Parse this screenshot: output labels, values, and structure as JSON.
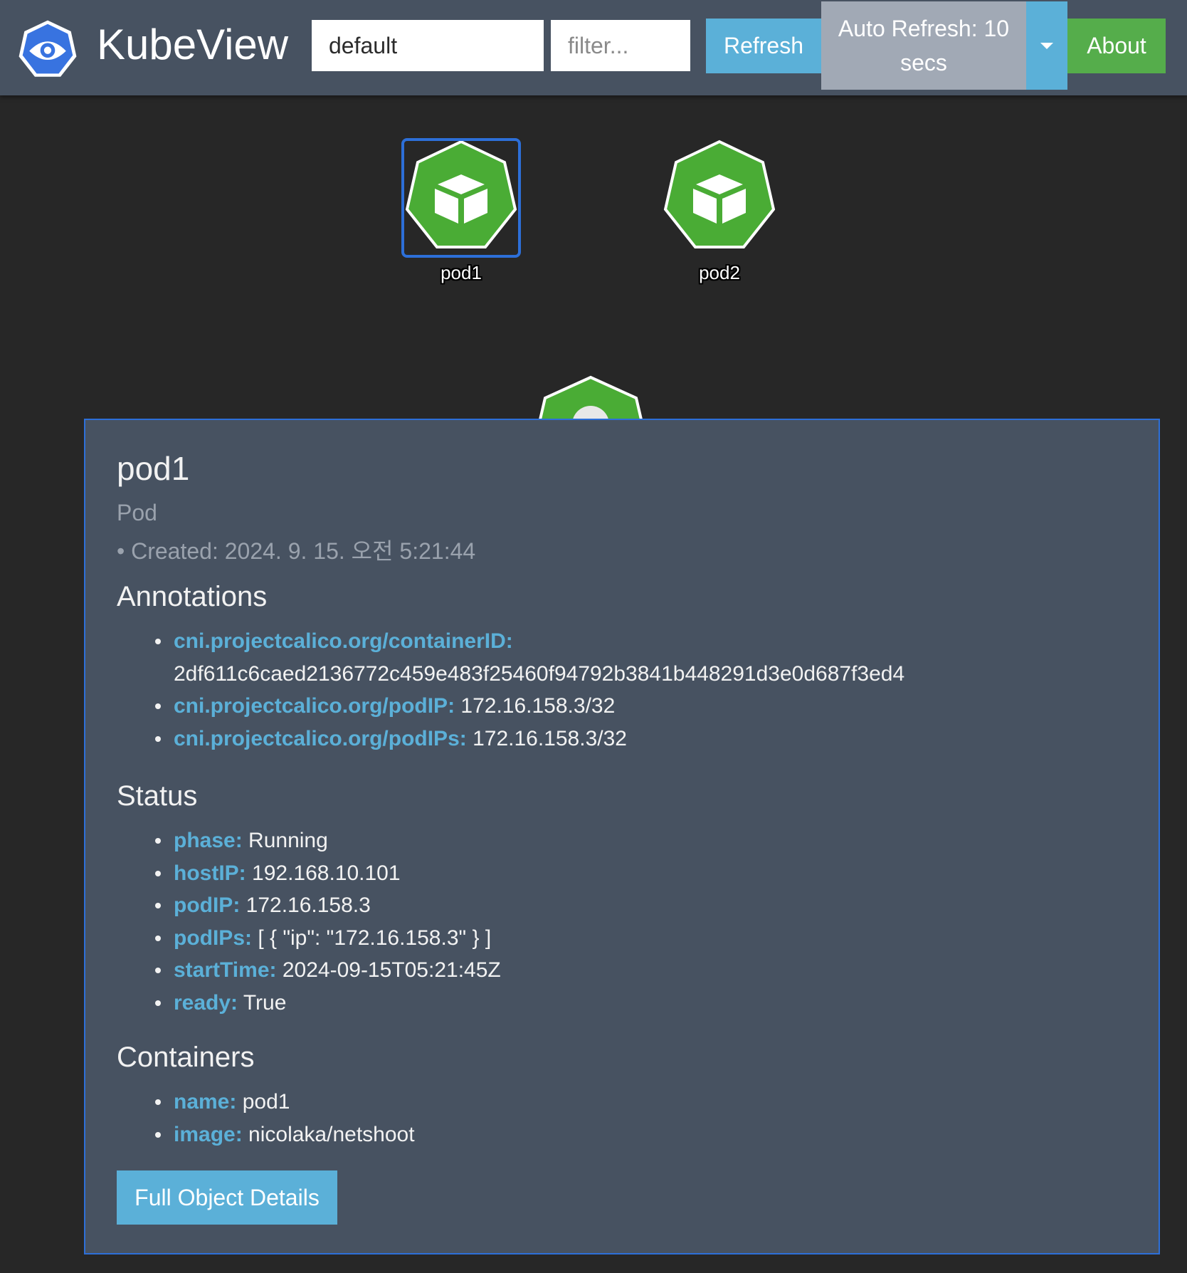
{
  "app": {
    "title": "KubeView",
    "namespace_value": "default",
    "filter_placeholder": "filter...",
    "refresh_label": "Refresh",
    "auto_refresh_label": "Auto Refresh: 10 secs",
    "about_label": "About",
    "colors": {
      "navbar": "#475261",
      "background": "#272727",
      "accent_blue": "#5bb0d8",
      "accent_green": "#55ad4b",
      "pod_green": "#4aac35",
      "selection_blue": "#2d6fd8"
    }
  },
  "graph": {
    "nodes": [
      {
        "label": "pod1",
        "selected": true,
        "icon": "pod-cube-icon"
      },
      {
        "label": "pod2",
        "selected": false,
        "icon": "pod-cube-icon"
      }
    ]
  },
  "panel": {
    "title": "pod1",
    "kind": "Pod",
    "created": "• Created: 2024. 9. 15. 오전 5:21:44",
    "annotations_heading": "Annotations",
    "annotations": [
      {
        "key": "cni.projectcalico.org/containerID:",
        "value": "2df611c6caed2136772c459e483f25460f94792b3841b448291d3e0d687f3ed4"
      },
      {
        "key": "cni.projectcalico.org/podIP:",
        "value": "172.16.158.3/32"
      },
      {
        "key": "cni.projectcalico.org/podIPs:",
        "value": "172.16.158.3/32"
      }
    ],
    "status_heading": "Status",
    "status": [
      {
        "key": "phase:",
        "value": "Running"
      },
      {
        "key": "hostIP:",
        "value": "192.168.10.101"
      },
      {
        "key": "podIP:",
        "value": "172.16.158.3"
      },
      {
        "key": "podIPs:",
        "value": "[ { \"ip\": \"172.16.158.3\" } ]"
      },
      {
        "key": "startTime:",
        "value": "2024-09-15T05:21:45Z"
      },
      {
        "key": "ready:",
        "value": "True"
      }
    ],
    "containers_heading": "Containers",
    "containers": [
      {
        "key": "name:",
        "value": "pod1"
      },
      {
        "key": "image:",
        "value": "nicolaka/netshoot"
      }
    ],
    "full_details_label": "Full Object Details"
  }
}
